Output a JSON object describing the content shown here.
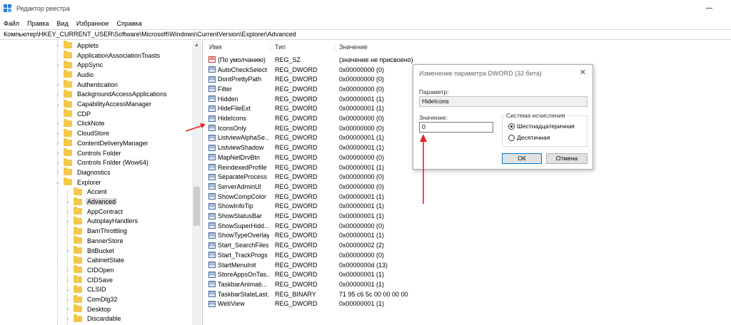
{
  "window": {
    "title": "Редактор реестра"
  },
  "menu": [
    "Файл",
    "Правка",
    "Вид",
    "Избранное",
    "Справка"
  ],
  "address": "Компьютер\\HKEY_CURRENT_USER\\Software\\Microsoft\\Windows\\CurrentVersion\\Explorer\\Advanced",
  "tree": [
    {
      "label": "Applets",
      "level": 1,
      "expandable": true
    },
    {
      "label": "ApplicationAssociationToasts",
      "level": 1,
      "expandable": false
    },
    {
      "label": "AppSync",
      "level": 1,
      "expandable": true
    },
    {
      "label": "Audio",
      "level": 1,
      "expandable": false
    },
    {
      "label": "Authentication",
      "level": 1,
      "expandable": true
    },
    {
      "label": "BackgroundAccessApplications",
      "level": 1,
      "expandable": true
    },
    {
      "label": "CapabilityAccessManager",
      "level": 1,
      "expandable": true
    },
    {
      "label": "CDP",
      "level": 1,
      "expandable": false
    },
    {
      "label": "ClickNote",
      "level": 1,
      "expandable": true
    },
    {
      "label": "CloudStore",
      "level": 1,
      "expandable": true
    },
    {
      "label": "ContentDeliveryManager",
      "level": 1,
      "expandable": true
    },
    {
      "label": "Controls Folder",
      "level": 1,
      "expandable": true
    },
    {
      "label": "Controls Folder (Wow64)",
      "level": 1,
      "expandable": true
    },
    {
      "label": "Diagnostics",
      "level": 1,
      "expandable": true
    },
    {
      "label": "Explorer",
      "level": 1,
      "expandable": true,
      "expanded": true
    },
    {
      "label": "Accent",
      "level": 2,
      "expandable": false
    },
    {
      "label": "Advanced",
      "level": 2,
      "expandable": true,
      "selected": true
    },
    {
      "label": "AppContract",
      "level": 2,
      "expandable": true
    },
    {
      "label": "AutoplayHandlers",
      "level": 2,
      "expandable": true
    },
    {
      "label": "BamThrottling",
      "level": 2,
      "expandable": false
    },
    {
      "label": "BannerStore",
      "level": 2,
      "expandable": false
    },
    {
      "label": "BitBucket",
      "level": 2,
      "expandable": true
    },
    {
      "label": "CabinetState",
      "level": 2,
      "expandable": false
    },
    {
      "label": "CIDOpen",
      "level": 2,
      "expandable": true
    },
    {
      "label": "CIDSave",
      "level": 2,
      "expandable": true
    },
    {
      "label": "CLSID",
      "level": 2,
      "expandable": true
    },
    {
      "label": "ComDlg32",
      "level": 2,
      "expandable": true
    },
    {
      "label": "Desktop",
      "level": 2,
      "expandable": true
    },
    {
      "label": "Discardable",
      "level": 2,
      "expandable": true
    }
  ],
  "columns": {
    "name": "Имя",
    "type": "Тип",
    "value": "Значение"
  },
  "values": [
    {
      "name": "(По умолчанию)",
      "type": "REG_SZ",
      "value": "(значение не присвоено)",
      "icon": "ab"
    },
    {
      "name": "AutoCheckSelect",
      "type": "REG_DWORD",
      "value": "0x00000000 (0)",
      "icon": "dword"
    },
    {
      "name": "DontPrettyPath",
      "type": "REG_DWORD",
      "value": "0x00000000 (0)",
      "icon": "dword"
    },
    {
      "name": "Filter",
      "type": "REG_DWORD",
      "value": "0x00000000 (0)",
      "icon": "dword"
    },
    {
      "name": "Hidden",
      "type": "REG_DWORD",
      "value": "0x00000001 (1)",
      "icon": "dword"
    },
    {
      "name": "HideFileExt",
      "type": "REG_DWORD",
      "value": "0x00000001 (1)",
      "icon": "dword"
    },
    {
      "name": "HideIcons",
      "type": "REG_DWORD",
      "value": "0x00000000 (0)",
      "icon": "dword"
    },
    {
      "name": "IconsOnly",
      "type": "REG_DWORD",
      "value": "0x00000000 (0)",
      "icon": "dword"
    },
    {
      "name": "ListviewAlphaSe...",
      "type": "REG_DWORD",
      "value": "0x00000001 (1)",
      "icon": "dword"
    },
    {
      "name": "ListviewShadow",
      "type": "REG_DWORD",
      "value": "0x00000001 (1)",
      "icon": "dword"
    },
    {
      "name": "MapNetDrvBtn",
      "type": "REG_DWORD",
      "value": "0x00000000 (0)",
      "icon": "dword"
    },
    {
      "name": "ReindexedProfile",
      "type": "REG_DWORD",
      "value": "0x00000001 (1)",
      "icon": "dword"
    },
    {
      "name": "SeparateProcess",
      "type": "REG_DWORD",
      "value": "0x00000000 (0)",
      "icon": "dword"
    },
    {
      "name": "ServerAdminUI",
      "type": "REG_DWORD",
      "value": "0x00000000 (0)",
      "icon": "dword"
    },
    {
      "name": "ShowCompColor",
      "type": "REG_DWORD",
      "value": "0x00000001 (1)",
      "icon": "dword"
    },
    {
      "name": "ShowInfoTip",
      "type": "REG_DWORD",
      "value": "0x00000001 (1)",
      "icon": "dword"
    },
    {
      "name": "ShowStatusBar",
      "type": "REG_DWORD",
      "value": "0x00000001 (1)",
      "icon": "dword"
    },
    {
      "name": "ShowSuperHidd...",
      "type": "REG_DWORD",
      "value": "0x00000000 (0)",
      "icon": "dword"
    },
    {
      "name": "ShowTypeOverlay",
      "type": "REG_DWORD",
      "value": "0x00000001 (1)",
      "icon": "dword"
    },
    {
      "name": "Start_SearchFiles",
      "type": "REG_DWORD",
      "value": "0x00000002 (2)",
      "icon": "dword"
    },
    {
      "name": "Start_TrackProgs",
      "type": "REG_DWORD",
      "value": "0x00000000 (0)",
      "icon": "dword"
    },
    {
      "name": "StartMenuInit",
      "type": "REG_DWORD",
      "value": "0x0000000d (13)",
      "icon": "dword"
    },
    {
      "name": "StoreAppsOnTas...",
      "type": "REG_DWORD",
      "value": "0x00000001 (1)",
      "icon": "dword"
    },
    {
      "name": "TaskbarAnimati...",
      "type": "REG_DWORD",
      "value": "0x00000001 (1)",
      "icon": "dword"
    },
    {
      "name": "TaskbarStateLast...",
      "type": "REG_BINARY",
      "value": "71 95 c6 5c 00 00 00 00",
      "icon": "binary"
    },
    {
      "name": "WebView",
      "type": "REG_DWORD",
      "value": "0x00000001 (1)",
      "icon": "dword"
    }
  ],
  "dialog": {
    "title": "Изменение параметра DWORD (32 бита)",
    "param_label": "Параметр:",
    "param_value": "HideIcons",
    "value_label": "Значение:",
    "value": "0",
    "base_title": "Система исчисления",
    "base_hex": "Шестнадцатеричная",
    "base_dec": "Десятичная",
    "ok": "ОК",
    "cancel": "Отмена",
    "close_glyph": "✕"
  },
  "accent_colors": {
    "arrow": "#e0242b",
    "folder": "#f3c84b"
  }
}
